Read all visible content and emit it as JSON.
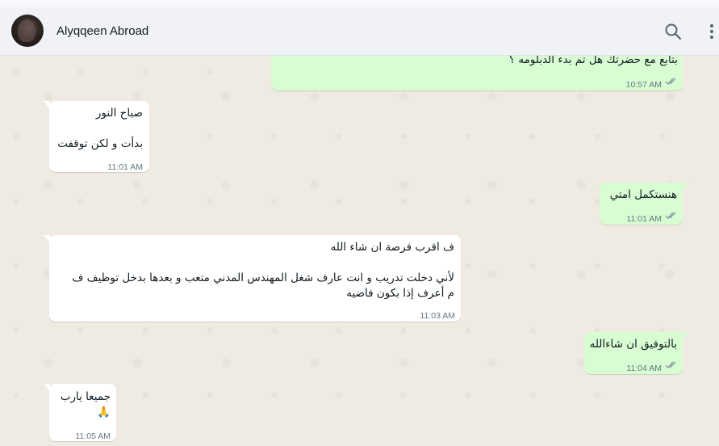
{
  "header": {
    "contact_name": "Alyqqeen Abroad",
    "search_icon": "search-icon",
    "menu_icon": "more-vertical-icon"
  },
  "colors": {
    "outgoing_bubble": "#d9fdd3",
    "incoming_bubble": "#ffffff",
    "chat_background": "#efeae2",
    "read_ticks": "#8696a0"
  },
  "messages": [
    {
      "direction": "out",
      "text": "بتابع مع حضرتك هل تم بدء الدبلومه ؟",
      "time": "10:57 AM",
      "status": "read"
    },
    {
      "direction": "in",
      "text": "صباح النور\n\nبدأت و لكن توقفت",
      "time": "11:01 AM"
    },
    {
      "direction": "out",
      "text": "هنستكمل امتي",
      "time": "11:01 AM",
      "status": "read"
    },
    {
      "direction": "in",
      "text": "ف اقرب فرصة ان شاء الله\n\nلأني دخلت تدريب و انت عارف شغل المهندس المدني متعب و بعدها بدخل توظيف ف\nم أعرف إذا بكون فاضيه",
      "time": "11:03 AM"
    },
    {
      "direction": "out",
      "text": "بالتوفيق ان شاءالله",
      "time": "11:04 AM",
      "status": "read"
    },
    {
      "direction": "in",
      "text": "جميعا يارب\n🙏",
      "time": "11:05 AM"
    }
  ]
}
